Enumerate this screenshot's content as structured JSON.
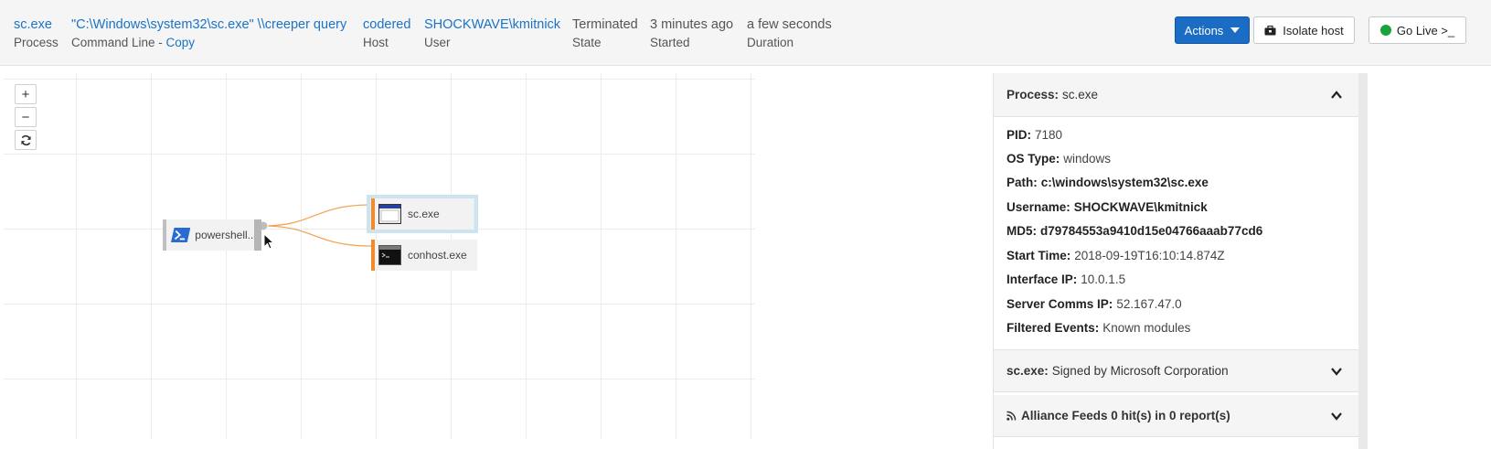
{
  "header": {
    "process_name": "sc.exe",
    "process_label": "Process",
    "command_line": "\"C:\\Windows\\system32\\sc.exe\" \\\\creeper query",
    "command_line_label": "Command Line - ",
    "copy_label": "Copy",
    "host": "codered",
    "host_label": "Host",
    "user": "SHOCKWAVE\\kmitnick",
    "user_label": "User",
    "state": "Terminated",
    "state_label": "State",
    "started": "3 minutes ago",
    "started_label": "Started",
    "duration": "a few seconds",
    "duration_label": "Duration"
  },
  "toolbar": {
    "actions_label": "Actions",
    "isolate_label": "Isolate host",
    "golive_label": "Go Live >_"
  },
  "graph": {
    "zoom_in": "+",
    "zoom_out": "−",
    "reset_icon": "refresh-icon",
    "nodes": {
      "parent": "powershell....",
      "child1": "sc.exe",
      "child2": "conhost.exe"
    },
    "edge_color": "#f3a65a"
  },
  "panel": {
    "process_section": {
      "title_key": "Process:",
      "title_value": "sc.exe"
    },
    "fields": {
      "pid_key": "PID:",
      "pid": "7180",
      "os_key": "OS Type:",
      "os": "windows",
      "path_key": "Path:",
      "path": "c:\\windows\\system32\\sc.exe",
      "username_key": "Username:",
      "username": "SHOCKWAVE\\kmitnick",
      "md5_key": "MD5:",
      "md5": "d79784553a9410d15e04766aaab77cd6",
      "start_key": "Start Time:",
      "start": "2018-09-19T16:10:14.874Z",
      "iface_key": "Interface IP:",
      "iface": "10.0.1.5",
      "server_key": "Server Comms IP:",
      "server": "52.167.47.0",
      "filtered_key": "Filtered Events:",
      "filtered": "Known modules"
    },
    "signed_section": {
      "title_key": "sc.exe:",
      "title_value": "Signed by Microsoft Corporation"
    },
    "feeds_section": {
      "title": "Alliance Feeds 0 hit(s) in 0 report(s)"
    }
  },
  "colors": {
    "accent_blue": "#1a6cc4",
    "link_blue": "#1a73c8",
    "node_orange": "#f08c2b",
    "live_green": "#19a33a"
  }
}
